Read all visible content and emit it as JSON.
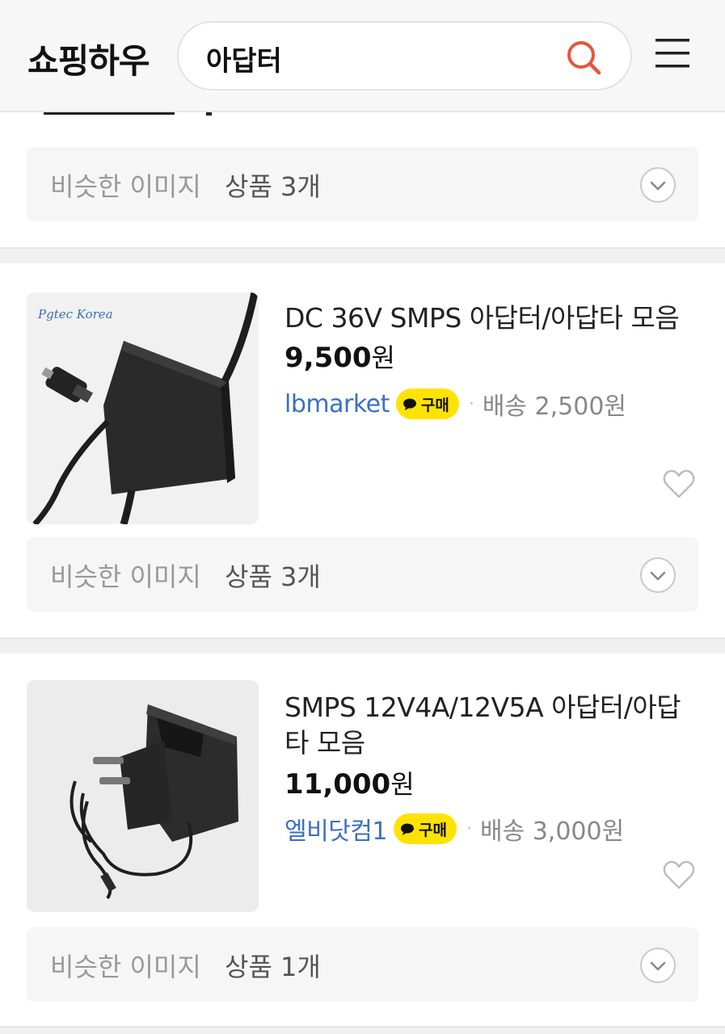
{
  "header": {
    "logo": "쇼핑하우",
    "search_value": "아답터"
  },
  "top_similar": {
    "label": "비슷한 이미지",
    "count": "상품 3개"
  },
  "products": [
    {
      "brand_watermark": "Pgtec Korea",
      "title": "DC 36V SMPS 아답터/아답타 모음",
      "price": "9,500",
      "currency": "원",
      "seller": "lbmarket",
      "badge": "구매",
      "shipping": "배송 2,500원",
      "similar_label": "비슷한 이미지",
      "similar_count": "상품 3개"
    },
    {
      "title": "SMPS 12V4A/12V5A 아답터/아답타 모음",
      "price": "11,000",
      "currency": "원",
      "seller": "엘비닷컴1",
      "badge": "구매",
      "shipping": "배송 3,000원",
      "similar_label": "비슷한 이미지",
      "similar_count": "상품 1개"
    }
  ],
  "colors": {
    "accent": "#e8553d",
    "seller_link": "#3b6fc6",
    "badge": "#ffe300"
  }
}
